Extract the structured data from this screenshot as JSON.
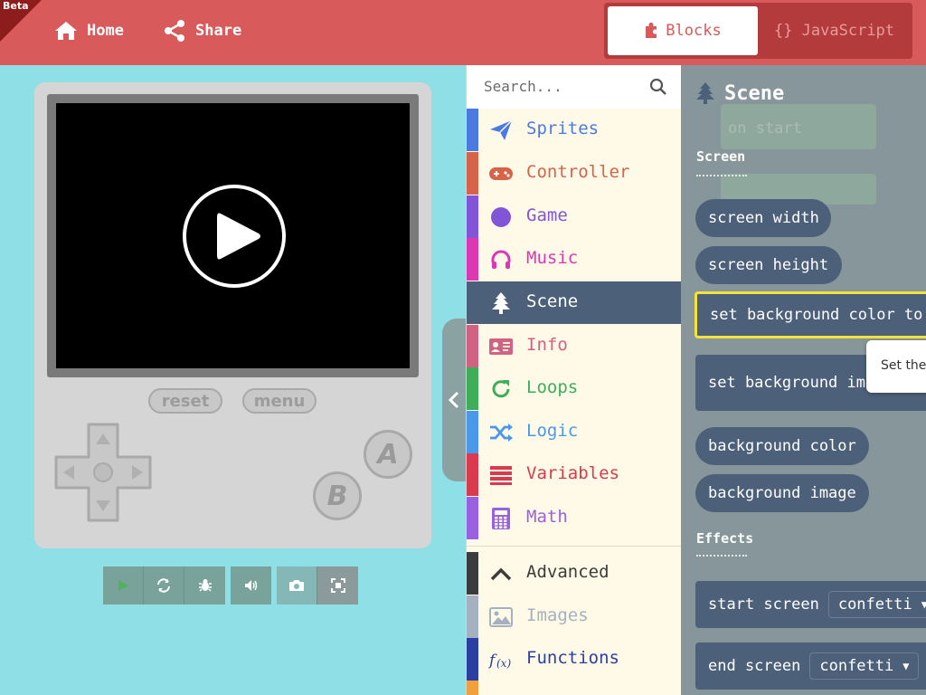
{
  "header": {
    "beta": "Beta",
    "home": "Home",
    "share": "Share",
    "blocks": "Blocks",
    "javascript": "{} JavaScript"
  },
  "simulator": {
    "reset": "reset",
    "menu": "menu",
    "button_a": "A",
    "button_b": "B"
  },
  "toolbox": {
    "search_placeholder": "Search...",
    "categories": [
      {
        "label": "Sprites",
        "color": "#4b7be0",
        "icon": "paper-plane-icon"
      },
      {
        "label": "Controller",
        "color": "#d5644a",
        "icon": "gamepad-icon"
      },
      {
        "label": "Game",
        "color": "#8254d6",
        "icon": "circle-icon"
      },
      {
        "label": "Music",
        "color": "#dd38b4",
        "icon": "headphones-icon"
      },
      {
        "label": "Scene",
        "color": "#4d6079",
        "icon": "tree-icon"
      },
      {
        "label": "Info",
        "color": "#cf6381",
        "icon": "id-card-icon"
      },
      {
        "label": "Loops",
        "color": "#3fae5b",
        "icon": "refresh-icon"
      },
      {
        "label": "Logic",
        "color": "#4b98e9",
        "icon": "shuffle-icon"
      },
      {
        "label": "Variables",
        "color": "#d83a4e",
        "icon": "list-icon"
      },
      {
        "label": "Math",
        "color": "#9960e0",
        "icon": "calculator-icon"
      },
      {
        "label": "Advanced",
        "color": "#3c3c3c",
        "icon": "chevron-up-icon"
      },
      {
        "label": "Images",
        "color": "#a5b1c0",
        "icon": "image-icon"
      },
      {
        "label": "Functions",
        "color": "#2b3fa0",
        "icon": "function-icon"
      }
    ]
  },
  "flyout": {
    "title": "Scene",
    "ghost_label": "on start",
    "section_screen": "Screen",
    "section_effects": "Effects",
    "blocks": {
      "screen_width": "screen width",
      "screen_height": "screen height",
      "set_bg_color": "set background color to",
      "set_bg_image": "set background ima",
      "bg_color": "background color",
      "bg_image": "background image",
      "start_screen": "start screen",
      "end_screen": "end screen",
      "confetti": "confetti"
    },
    "tooltip": "Set the"
  }
}
